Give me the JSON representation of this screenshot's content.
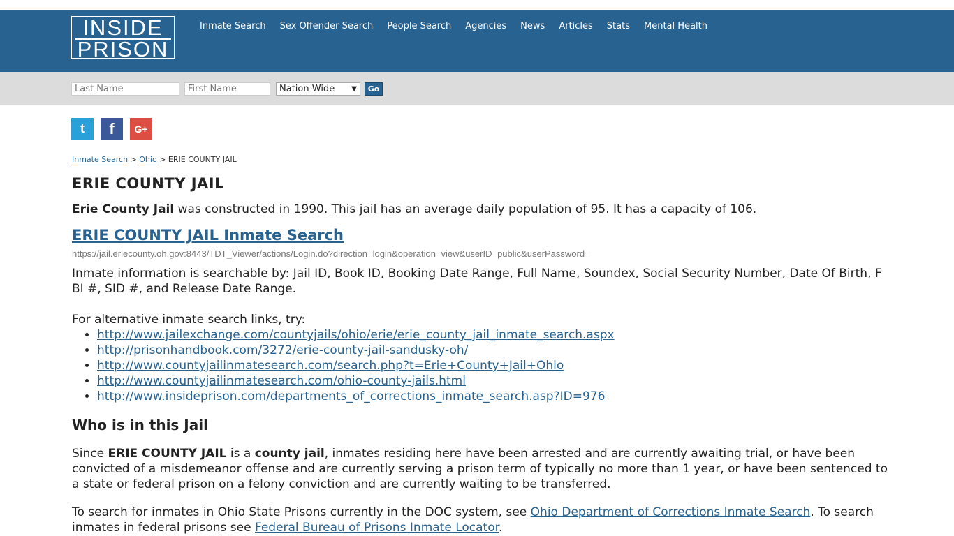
{
  "logo": {
    "line1": "INSIDE",
    "line2": "PRISON"
  },
  "nav": [
    "Inmate Search",
    "Sex Offender Search",
    "People Search",
    "Agencies",
    "News",
    "Articles",
    "Stats",
    "Mental Health"
  ],
  "search": {
    "last_placeholder": "Last Name",
    "first_placeholder": "First Name",
    "scope": "Nation-Wide",
    "go": "Go"
  },
  "social": {
    "twitter": "t",
    "facebook": "f",
    "google": "G+"
  },
  "breadcrumb": {
    "home": "Inmate Search",
    "sep1": " > ",
    "state": "Ohio",
    "sep2": " > ",
    "current": "ERIE COUNTY JAIL"
  },
  "title": "ERIE COUNTY JAIL",
  "intro": {
    "bold": "Erie County Jail",
    "rest": " was constructed in 1990. This jail has an average daily population of 95. It has a capacity of 106."
  },
  "search_link": "ERIE COUNTY JAIL Inmate Search",
  "search_url": "https://jail.eriecounty.oh.gov:8443/TDT_Viewer/actions/Login.do?direction=login&operation=view&userID=public&userPassword=",
  "searchable": "Inmate information is searchable by: Jail ID, Book ID, Booking Date Range, Full Name, Soundex, Social Security Number, Date Of Birth, FBI #, SID #, and Release Date Range.",
  "alt_intro": "For alternative inmate search links, try:",
  "alt_links": [
    "http://www.jailexchange.com/countyjails/ohio/erie/erie_county_jail_inmate_search.aspx",
    "http://prisonhandbook.com/3272/erie-county-jail-sandusky-oh/",
    "http://www.countyjailinmatesearch.com/search.php?t=Erie+County+Jail+Ohio",
    "http://www.countyjailinmatesearch.com/ohio-county-jails.html",
    "http://www.insideprison.com/departments_of_corrections_inmate_search.asp?ID=976"
  ],
  "who_title": "Who is in this Jail",
  "who": {
    "p1": "Since ",
    "b1": "ERIE COUNTY JAIL",
    "p2": " is a ",
    "b2": "county jail",
    "p3": ", inmates residing here have been arrested and are currently awaiting trial, or have been convicted of a misdemeanor offense and are currently serving a prison term of typically no more than 1 year, or have been sentenced to a state or federal prison on a felony conviction and are currently waiting to be transferred."
  },
  "doc": {
    "p1": "To search for inmates in Ohio State Prisons currently in the DOC system, see ",
    "link1": "Ohio Department of Corrections Inmate Search",
    "p2": ". To search inmates in federal prisons see ",
    "link2": "Federal Bureau of Prisons Inmate Locator",
    "p3": "."
  },
  "colors": {
    "brand": "#276291",
    "searchbar": "#dcdcdc"
  }
}
